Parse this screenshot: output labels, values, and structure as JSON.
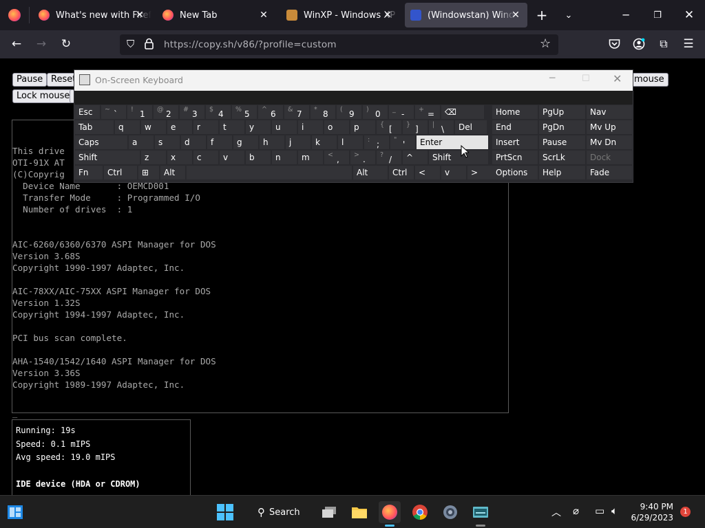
{
  "browser": {
    "tabs": [
      {
        "title": "What's new with Firefox",
        "icon": "firefox-icon",
        "color": "#ff7139",
        "active": false
      },
      {
        "title": "New Tab",
        "icon": "firefox-icon",
        "color": "#ff7139",
        "active": false
      },
      {
        "title": "WinXP - Windows XP in",
        "icon": "winxp-icon",
        "color": "#c98b3a",
        "active": false
      },
      {
        "title": "(Windowstan) Windows",
        "icon": "windowstan-icon",
        "color": "#3355cc",
        "active": true
      }
    ],
    "url": "https://copy.sh/v86/?profile=custom"
  },
  "page": {
    "buttons": {
      "pause": "Pause",
      "reset": "Reset",
      "lock_mouse": "Lock mouse",
      "mouse_partial": "mouse"
    },
    "console_text": "This drive\nOTI-91X AT\n(C)Copyrig\n  Device Name       : OEMCD001\n  Transfer Mode     : Programmed I/O\n  Number of drives  : 1\n\n\nAIC-6260/6360/6370 ASPI Manager for DOS\nVersion 3.68S\nCopyright 1990-1997 Adaptec, Inc.\n\nAIC-78XX/AIC-75XX ASPI Manager for DOS\nVersion 1.32S\nCopyright 1994-1997 Adaptec, Inc.\n\nPCI bus scan complete.\n\nAHA-1540/1542/1640 ASPI Manager for DOS\nVersion 3.36S\nCopyright 1989-1997 Adaptec, Inc.",
    "cursor": "_",
    "stats": {
      "running": "Running: 19s",
      "speed": "Speed: 0.1 mIPS",
      "avg_speed": "Avg speed: 19.0 mIPS",
      "ide_heading": "IDE device (HDA or CDROM)"
    }
  },
  "osk": {
    "title": "On-Screen Keyboard",
    "row1": [
      {
        "t": "Esc"
      },
      {
        "s": "~",
        "m": "`"
      },
      {
        "s": "!",
        "m": "1"
      },
      {
        "s": "@",
        "m": "2"
      },
      {
        "s": "#",
        "m": "3"
      },
      {
        "s": "$",
        "m": "4"
      },
      {
        "s": "%",
        "m": "5"
      },
      {
        "s": "^",
        "m": "6"
      },
      {
        "s": "&",
        "m": "7"
      },
      {
        "s": "*",
        "m": "8"
      },
      {
        "s": "(",
        "m": "9"
      },
      {
        "s": ")",
        "m": "0"
      },
      {
        "s": "_",
        "m": "-"
      },
      {
        "s": "+",
        "m": "="
      },
      {
        "t": "⌫"
      }
    ],
    "row2": [
      "Tab",
      "q",
      "w",
      "e",
      "r",
      "t",
      "y",
      "u",
      "i",
      "o",
      "p",
      "[",
      "]",
      "\\",
      "Del"
    ],
    "row2_shift": [
      "",
      "",
      "",
      "",
      "",
      "",
      "",
      "",
      "",
      "",
      "",
      "{",
      "}",
      "|",
      ""
    ],
    "row3": [
      "Caps",
      "a",
      "s",
      "d",
      "f",
      "g",
      "h",
      "j",
      "k",
      "l",
      ";",
      "'",
      "Enter"
    ],
    "row3_shift": [
      "",
      "",
      "",
      "",
      "",
      "",
      "",
      "",
      "",
      "",
      ":",
      "\"",
      ""
    ],
    "row4": [
      "Shift",
      "z",
      "x",
      "c",
      "v",
      "b",
      "n",
      "m",
      ",",
      ".",
      "/",
      "^",
      "Shift"
    ],
    "row4_shift": [
      "",
      "",
      "",
      "",
      "",
      "",
      "",
      "",
      "<",
      ">",
      "?",
      "",
      ""
    ],
    "row5": [
      "Fn",
      "Ctrl",
      "⊞",
      "Alt",
      "",
      "Alt",
      "Ctrl",
      "<",
      "v",
      ">",
      "▤"
    ],
    "nav": [
      [
        "Home",
        "PgUp",
        "Nav"
      ],
      [
        "End",
        "PgDn",
        "Mv Up"
      ],
      [
        "Insert",
        "Pause",
        "Mv Dn"
      ],
      [
        "PrtScn",
        "ScrLk",
        "Dock"
      ],
      [
        "Options",
        "Help",
        "Fade"
      ]
    ]
  },
  "taskbar": {
    "search_label": "Search",
    "time": "9:40 PM",
    "date": "6/29/2023",
    "notification_count": "1"
  }
}
